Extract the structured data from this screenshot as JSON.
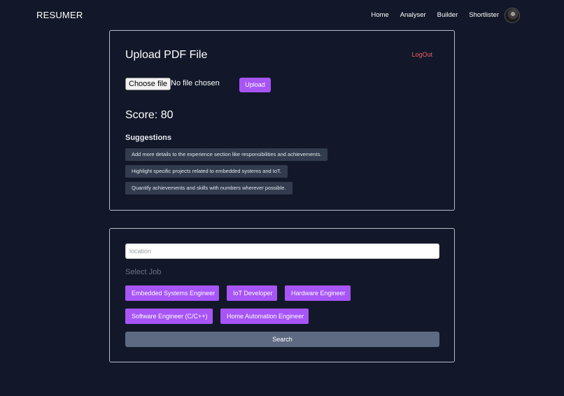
{
  "nav": {
    "brand": "RESUMER",
    "links": [
      "Home",
      "Analyser",
      "Builder",
      "Shortlister"
    ]
  },
  "upload_card": {
    "title": "Upload PDF File",
    "logout_label": "LogOut",
    "file_button_label": "Choose file",
    "file_status": "No file chosen",
    "upload_label": "Upload",
    "score_text": "Score: 80",
    "suggestions_title": "Suggestions",
    "suggestions": [
      "Add more details to the experience section like responsibilities and achievements.",
      "Highlight specific projects related to embedded systems and IoT.",
      "Quantify achievements and skills with numbers wherever possible."
    ]
  },
  "job_card": {
    "location_placeholder": "location",
    "location_value": "",
    "select_label": "Select Job",
    "jobs": [
      "Embedded Systems Engineer",
      "IoT Developer",
      "Hardware Engineer",
      "Software Engineer (C/C++)",
      "Home Automation Engineer"
    ],
    "search_label": "Search"
  },
  "colors": {
    "background": "#121829",
    "accent": "#a755f7",
    "logout": "#f25f6c",
    "suggestion_bg": "#323c4e",
    "search_bg": "#5e6a82"
  }
}
